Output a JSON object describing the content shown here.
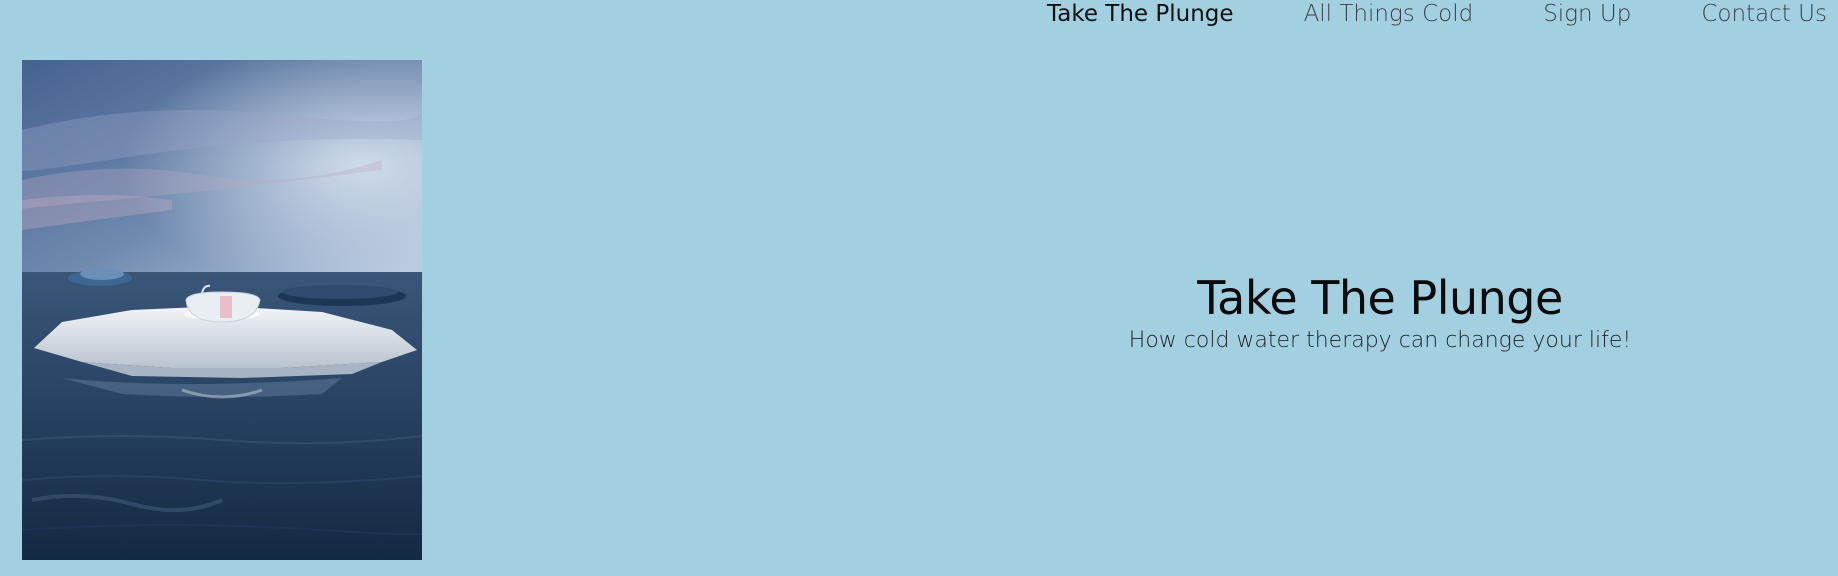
{
  "nav": {
    "items": [
      {
        "label": "Take The Plunge",
        "active": true
      },
      {
        "label": "All Things Cold",
        "active": false
      },
      {
        "label": "Sign Up",
        "active": false
      },
      {
        "label": "Contact Us",
        "active": false
      }
    ]
  },
  "hero": {
    "title": "Take The Plunge",
    "subtitle": "How cold water therapy can change your life!",
    "image_alt": "surreal floating ice floe with a bathtub on calm dark water"
  },
  "colors": {
    "background": "#a2d0e1",
    "sky_top": "#4a6a95",
    "water": "#1c3350"
  }
}
